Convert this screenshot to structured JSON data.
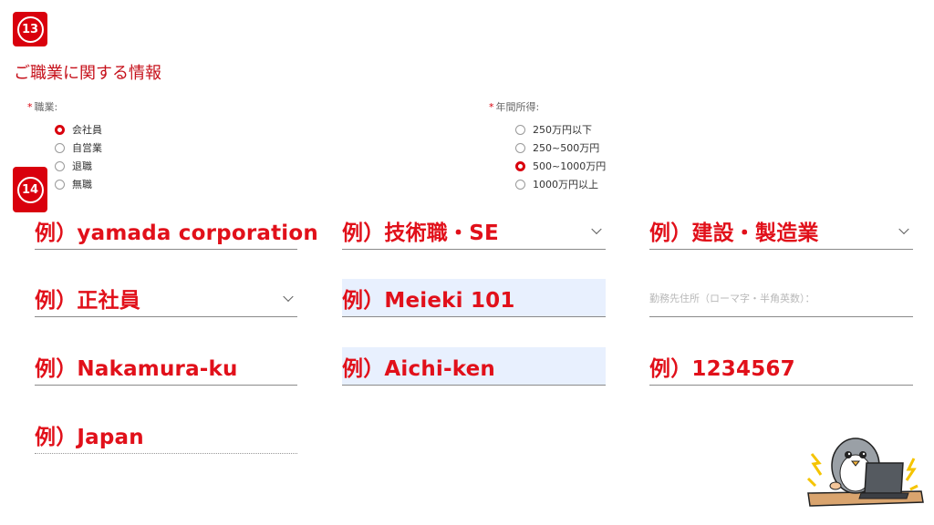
{
  "steps": {
    "step13": "13",
    "step14": "14"
  },
  "section_title": "ご職業に関する情報",
  "occupation": {
    "label": "職業:",
    "required_mark": "*",
    "options": [
      "会社員",
      "自営業",
      "退職",
      "無職"
    ],
    "selected": "会社員"
  },
  "income": {
    "label": "年間所得:",
    "required_mark": "*",
    "options": [
      "250万円以下",
      "250~500万円",
      "500~1000万円",
      "1000万円以上"
    ],
    "selected": "500~1000万円"
  },
  "fields": {
    "company_name": "例）yamada corporation",
    "job_type": "例）技術職・SE",
    "industry": "例）建設・製造業",
    "employment_type": "例）正社員",
    "address_line": "例）Meieki 101",
    "work_address_placeholder": "勤務先住所（ローマ字・半角英数）：",
    "city": "例）Nakamura-ku",
    "prefecture": "例）Aichi-ken",
    "postal_code": "例）1234567",
    "country": "例）Japan"
  },
  "colors": {
    "accent": "#d9000d",
    "highlight_text": "#e1101a",
    "autofill_bg": "#e8f0fe"
  }
}
